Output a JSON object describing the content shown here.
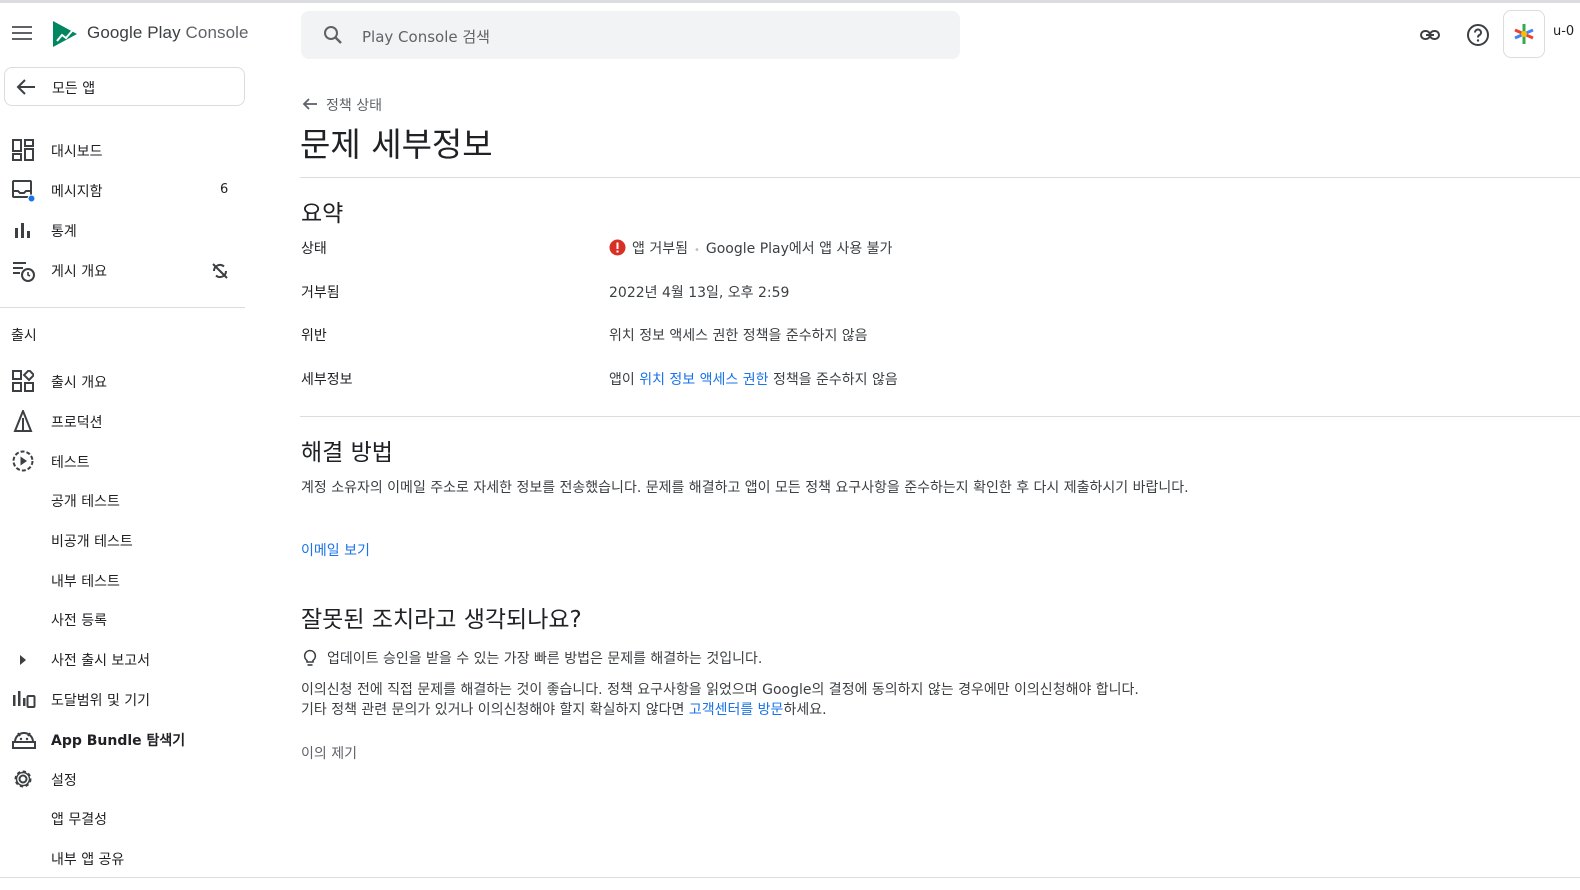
{
  "header": {
    "menu_icon": "hamburger-menu-icon",
    "logo_google": "Google Play",
    "logo_console": " Console",
    "search_placeholder": "Play Console 검색",
    "account_text": "u-0"
  },
  "sidebar": {
    "back_label": "모든 앱",
    "items": [
      {
        "label": "대시보드",
        "icon": "dashboard-icon"
      },
      {
        "label": "메시지함",
        "icon": "inbox-icon",
        "badge": "6"
      },
      {
        "label": "통계",
        "icon": "statistics-icon"
      },
      {
        "label": "게시 개요",
        "icon": "publishing-overview-icon"
      }
    ],
    "section_label": "출시",
    "release_items": [
      {
        "label": "출시 개요",
        "icon": "release-overview-icon"
      },
      {
        "label": "프로덕션",
        "icon": "production-icon"
      },
      {
        "label": "테스트",
        "icon": "testing-icon"
      },
      {
        "label": "공개 테스트"
      },
      {
        "label": "비공개 테스트"
      },
      {
        "label": "내부 테스트"
      },
      {
        "label": "사전 등록"
      },
      {
        "label": "사전 출시 보고서",
        "icon": "expand-arrow-icon"
      },
      {
        "label": "도달범위 및 기기",
        "icon": "reach-devices-icon"
      },
      {
        "label": "App Bundle 탐색기",
        "icon": "android-bundle-icon"
      },
      {
        "label": "설정",
        "icon": "settings-gear-icon"
      },
      {
        "label": "앱 무결성"
      },
      {
        "label": "내부 앱 공유"
      }
    ]
  },
  "main": {
    "breadcrumb": "정책 상태",
    "title": "문제 세부정보",
    "summary": {
      "heading": "요약",
      "rows": [
        {
          "label": "상태",
          "status_text": "앱 거부됨",
          "status_detail": "Google Play에서 앱 사용 불가"
        },
        {
          "label": "거부됨",
          "value": "2022년 4월 13일, 오후 2:59"
        },
        {
          "label": "위반",
          "value": "위치 정보 액세스 권한 정책을 준수하지 않음"
        },
        {
          "label": "세부정보",
          "value_prefix": "앱이 ",
          "value_link": "위치 정보 액세스 권한",
          "value_suffix": " 정책을 준수하지 않음"
        }
      ]
    },
    "resolve": {
      "heading": "해결 방법",
      "text": "계정 소유자의 이메일 주소로 자세한 정보를 전송했습니다. 문제를 해결하고 앱이 모든 정책 요구사항을 준수하는지 확인한 후 다시 제출하시기 바랍니다.",
      "link": "이메일 보기"
    },
    "appeal": {
      "heading": "잘못된 조치라고 생각되나요?",
      "tip": "업데이트 승인을 받을 수 있는 가장 빠른 방법은 문제를 해결하는 것입니다.",
      "para_line1": "이의신청 전에 직접 문제를 해결하는 것이 좋습니다. 정책 요구사항을 읽었으며 Google의 결정에 동의하지 않는 경우에만 이의신청해야 합니다.",
      "para_line2_prefix": "기타 정책 관련 문의가 있거나 이의신청해야 할지 확실하지 않다면 ",
      "para_line2_link": "고객센터를 방문",
      "para_line2_suffix": "하세요.",
      "button": "이의 제기"
    }
  },
  "colors": {
    "link": "#1a73e8",
    "error": "#d93025",
    "divider": "#dadce0",
    "badge_dot": "#1a73e8"
  }
}
